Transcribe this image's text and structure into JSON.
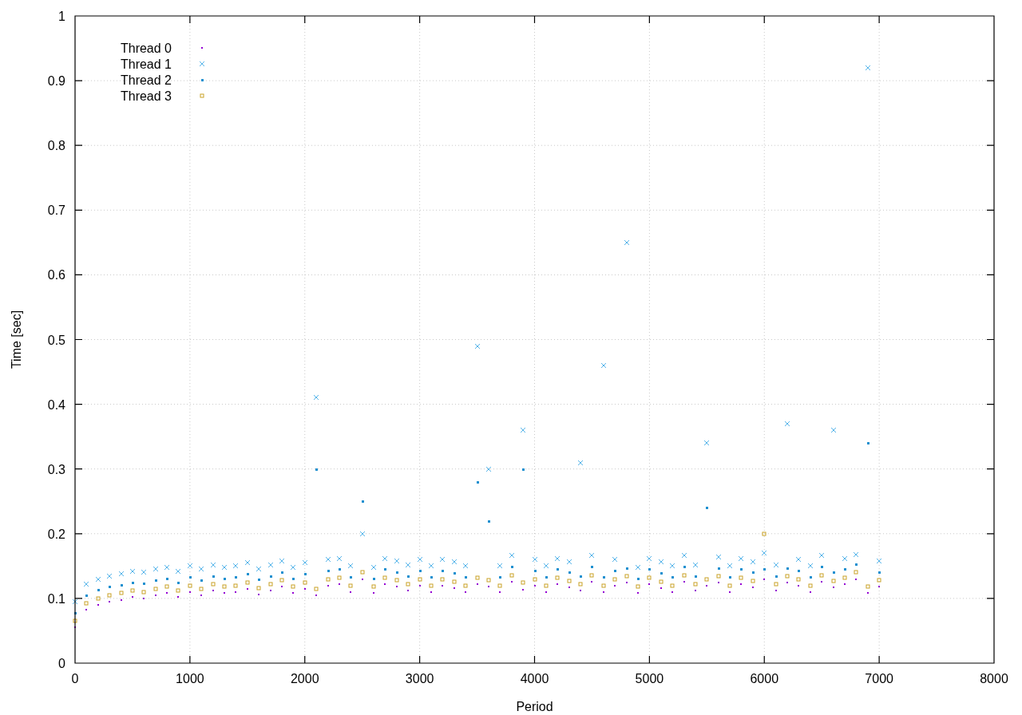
{
  "chart_data": {
    "type": "scatter",
    "grid": true,
    "legend": true,
    "xlabel": "Period",
    "ylabel": "Time [sec]",
    "xlim": [
      0,
      8000
    ],
    "ylim": [
      0,
      1
    ],
    "xticks": [
      0,
      1000,
      2000,
      3000,
      4000,
      5000,
      6000,
      7000,
      8000
    ],
    "yticks": [
      0,
      0.1,
      0.2,
      0.3,
      0.4,
      0.5,
      0.6,
      0.7,
      0.8,
      0.9,
      1
    ],
    "x": [
      0,
      100,
      200,
      300,
      400,
      500,
      600,
      700,
      800,
      900,
      1000,
      1100,
      1200,
      1300,
      1400,
      1500,
      1600,
      1700,
      1800,
      1900,
      2000,
      2100,
      2200,
      2300,
      2400,
      2500,
      2600,
      2700,
      2800,
      2900,
      3000,
      3100,
      3200,
      3300,
      3400,
      3500,
      3600,
      3700,
      3800,
      3900,
      4000,
      4100,
      4200,
      4300,
      4400,
      4500,
      4600,
      4700,
      4800,
      4900,
      5000,
      5100,
      5200,
      5300,
      5400,
      5500,
      5600,
      5700,
      5800,
      5900,
      6000,
      6100,
      6200,
      6300,
      6400,
      6500,
      6600,
      6700,
      6800,
      6900,
      7000
    ],
    "series": [
      {
        "name": "Thread 0",
        "color": "#9400d3",
        "values": [
          0.055,
          0.082,
          0.09,
          0.095,
          0.098,
          0.102,
          0.1,
          0.105,
          0.108,
          0.102,
          0.11,
          0.105,
          0.112,
          0.108,
          0.11,
          0.115,
          0.106,
          0.112,
          0.118,
          0.108,
          0.115,
          0.105,
          0.12,
          0.122,
          0.11,
          0.13,
          0.108,
          0.122,
          0.118,
          0.112,
          0.12,
          0.11,
          0.12,
          0.116,
          0.11,
          0.122,
          0.118,
          0.11,
          0.126,
          0.114,
          0.12,
          0.11,
          0.122,
          0.117,
          0.112,
          0.126,
          0.11,
          0.12,
          0.124,
          0.108,
          0.122,
          0.116,
          0.11,
          0.126,
          0.112,
          0.12,
          0.124,
          0.11,
          0.122,
          0.117,
          0.13,
          0.112,
          0.124,
          0.12,
          0.11,
          0.126,
          0.117,
          0.122,
          0.13,
          0.108,
          0.118
        ]
      },
      {
        "name": "Thread 1",
        "color": "#56b4e9",
        "values": [
          0.095,
          0.122,
          0.13,
          0.135,
          0.138,
          0.142,
          0.14,
          0.145,
          0.148,
          0.142,
          0.15,
          0.145,
          0.152,
          0.148,
          0.15,
          0.155,
          0.146,
          0.152,
          0.158,
          0.148,
          0.155,
          0.41,
          0.16,
          0.162,
          0.15,
          0.2,
          0.148,
          0.162,
          0.158,
          0.152,
          0.16,
          0.15,
          0.16,
          0.156,
          0.15,
          0.49,
          0.3,
          0.15,
          0.166,
          0.36,
          0.16,
          0.15,
          0.162,
          0.157,
          0.31,
          0.166,
          0.46,
          0.16,
          0.65,
          0.148,
          0.162,
          0.156,
          0.15,
          0.166,
          0.152,
          0.34,
          0.164,
          0.15,
          0.162,
          0.157,
          0.17,
          0.152,
          0.37,
          0.16,
          0.15,
          0.166,
          0.36,
          0.162,
          0.168,
          0.92,
          0.158
        ]
      },
      {
        "name": "Thread 2",
        "color": "#1e90d0",
        "values": [
          0.078,
          0.105,
          0.113,
          0.118,
          0.121,
          0.125,
          0.123,
          0.128,
          0.131,
          0.125,
          0.133,
          0.128,
          0.135,
          0.131,
          0.133,
          0.138,
          0.129,
          0.135,
          0.141,
          0.131,
          0.138,
          0.3,
          0.143,
          0.145,
          0.133,
          0.25,
          0.131,
          0.145,
          0.141,
          0.135,
          0.143,
          0.133,
          0.143,
          0.139,
          0.133,
          0.28,
          0.22,
          0.133,
          0.149,
          0.3,
          0.143,
          0.133,
          0.145,
          0.14,
          0.135,
          0.149,
          0.133,
          0.143,
          0.147,
          0.131,
          0.145,
          0.139,
          0.133,
          0.149,
          0.135,
          0.24,
          0.147,
          0.133,
          0.145,
          0.14,
          0.145,
          0.135,
          0.147,
          0.143,
          0.133,
          0.149,
          0.14,
          0.145,
          0.153,
          0.34,
          0.141
        ]
      },
      {
        "name": "Thread 3",
        "color": "#c9a227",
        "values": [
          0.065,
          0.092,
          0.1,
          0.105,
          0.108,
          0.112,
          0.11,
          0.115,
          0.118,
          0.112,
          0.12,
          0.115,
          0.122,
          0.118,
          0.12,
          0.125,
          0.116,
          0.122,
          0.128,
          0.118,
          0.125,
          0.115,
          0.13,
          0.132,
          0.12,
          0.14,
          0.118,
          0.132,
          0.128,
          0.122,
          0.13,
          0.12,
          0.13,
          0.126,
          0.12,
          0.132,
          0.128,
          0.12,
          0.136,
          0.124,
          0.13,
          0.12,
          0.132,
          0.127,
          0.122,
          0.136,
          0.12,
          0.13,
          0.134,
          0.118,
          0.132,
          0.126,
          0.12,
          0.136,
          0.122,
          0.13,
          0.134,
          0.12,
          0.132,
          0.127,
          0.2,
          0.122,
          0.134,
          0.13,
          0.12,
          0.136,
          0.127,
          0.132,
          0.14,
          0.118,
          0.128
        ]
      }
    ]
  }
}
